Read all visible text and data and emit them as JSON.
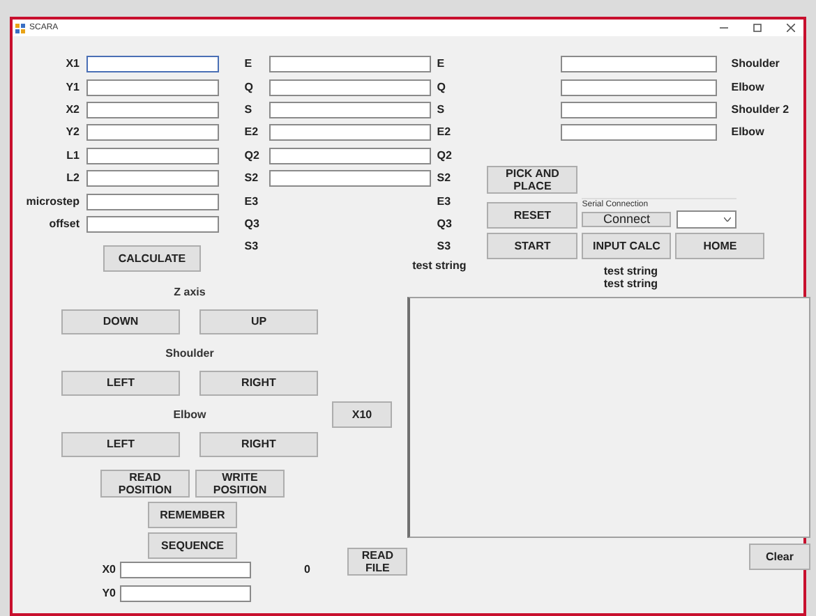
{
  "window": {
    "title": "SCARA"
  },
  "inputs": [
    {
      "label": "X1",
      "focused": true
    },
    {
      "label": "Y1",
      "focused": false
    },
    {
      "label": "X2",
      "focused": false
    },
    {
      "label": "Y2",
      "focused": false
    },
    {
      "label": "L1",
      "focused": false
    },
    {
      "label": "L2",
      "focused": false
    },
    {
      "label": "microstep",
      "focused": false
    },
    {
      "label": "offset",
      "focused": false
    }
  ],
  "calculate": "CALCULATE",
  "angle_rows": [
    {
      "label": "E",
      "unit": "E",
      "kind": "field"
    },
    {
      "label": "Q",
      "unit": "Q",
      "kind": "field"
    },
    {
      "label": "S",
      "unit": "S",
      "kind": "field"
    },
    {
      "label": "E2",
      "unit": "E2",
      "kind": "field"
    },
    {
      "label": "Q2",
      "unit": "Q2",
      "kind": "field"
    },
    {
      "label": "S2",
      "unit": "S2",
      "kind": "field"
    },
    {
      "label": "E3",
      "unit": "E3",
      "kind": "text"
    },
    {
      "label": "Q3",
      "unit": "Q3",
      "kind": "text"
    },
    {
      "label": "S3",
      "unit": "S3",
      "kind": "text"
    }
  ],
  "angle_status": "test string",
  "joint_fields": [
    {
      "label": "Shoulder"
    },
    {
      "label": "Elbow"
    },
    {
      "label": "Shoulder 2"
    },
    {
      "label": "Elbow"
    }
  ],
  "pick_and_place": "PICK AND PLACE",
  "reset": "RESET",
  "serial": {
    "group_label": "Serial Connection",
    "connect": "Connect"
  },
  "start": "START",
  "input_calc": "INPUT CALC",
  "home": "HOME",
  "status_lines": [
    "test string",
    "test string"
  ],
  "jog_groups": [
    {
      "heading": "Z axis",
      "buttons": [
        "DOWN",
        "UP"
      ]
    },
    {
      "heading": "Shoulder",
      "buttons": [
        "LEFT",
        "RIGHT"
      ]
    },
    {
      "heading": "Elbow",
      "buttons": [
        "LEFT",
        "RIGHT"
      ],
      "side_button": "X10"
    }
  ],
  "read_position": "READ POSITION",
  "write_position": "WRITE POSITION",
  "remember": "REMEMBER",
  "sequence": "SEQUENCE",
  "origin": [
    {
      "label": "X0"
    },
    {
      "label": "Y0"
    }
  ],
  "origin_value": "0",
  "read_file": "READ FILE",
  "clear": "Clear"
}
